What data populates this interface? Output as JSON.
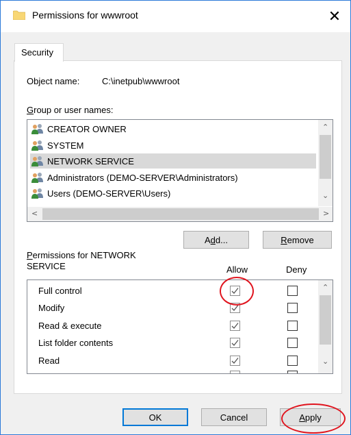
{
  "window": {
    "title": "Permissions for wwwroot",
    "close_symbol": "✕"
  },
  "tabs": [
    {
      "label": "Security",
      "selected": true
    }
  ],
  "object": {
    "label": "Object name:",
    "value": "C:\\inetpub\\wwwroot"
  },
  "groups": {
    "label_accel": "G",
    "label_rest": "roup or user names:",
    "items": [
      {
        "label": "CREATOR OWNER",
        "selected": false
      },
      {
        "label": "SYSTEM",
        "selected": false
      },
      {
        "label": "NETWORK SERVICE",
        "selected": true
      },
      {
        "label": "Administrators (DEMO-SERVER\\Administrators)",
        "selected": false
      },
      {
        "label": "Users (DEMO-SERVER\\Users)",
        "selected": false
      }
    ]
  },
  "buttons": {
    "add_pre": "A",
    "add_accel": "d",
    "add_post": "d...",
    "remove_accel": "R",
    "remove_rest": "emove",
    "ok": "OK",
    "cancel": "Cancel",
    "apply_accel": "A",
    "apply_rest": "pply"
  },
  "permissions": {
    "header_accel": "P",
    "header_line1": "ermissions for NETWORK",
    "header_line2": "SERVICE",
    "allow_label": "Allow",
    "deny_label": "Deny",
    "items": [
      {
        "label": "Full control",
        "allow": true,
        "deny": false
      },
      {
        "label": "Modify",
        "allow": true,
        "deny": false
      },
      {
        "label": "Read & execute",
        "allow": true,
        "deny": false
      },
      {
        "label": "List folder contents",
        "allow": true,
        "deny": false
      },
      {
        "label": "Read",
        "allow": true,
        "deny": false
      }
    ]
  },
  "colors": {
    "accent": "#0078d7",
    "highlight_annotation": "#e0141e",
    "selection": "#d9d9d9"
  }
}
